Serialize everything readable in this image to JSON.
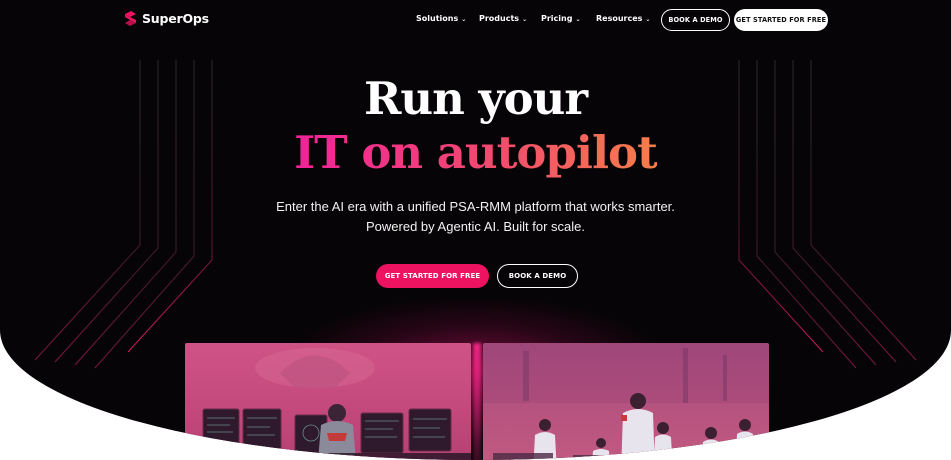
{
  "brand": {
    "name": "SuperOps",
    "accent": "#ee1360"
  },
  "nav": {
    "items": [
      {
        "label": "Solutions"
      },
      {
        "label": "Products"
      },
      {
        "label": "Pricing"
      },
      {
        "label": "Resources"
      }
    ],
    "book_demo_label": "BOOK A DEMO",
    "get_started_label": "GET STARTED FOR FREE"
  },
  "hero": {
    "title_line1": "Run your",
    "title_line2": "IT on autopilot",
    "subtitle_line1": "Enter the AI era with a unified PSA-RMM platform that works smarter.",
    "subtitle_line2": "Powered by Agentic AI. Built for scale.",
    "primary_cta": "GET STARTED FOR FREE",
    "secondary_cta": "BOOK A DEMO"
  },
  "icons": {
    "logo": "superops-logo-icon",
    "dropdown": "chevron-down-icon"
  }
}
